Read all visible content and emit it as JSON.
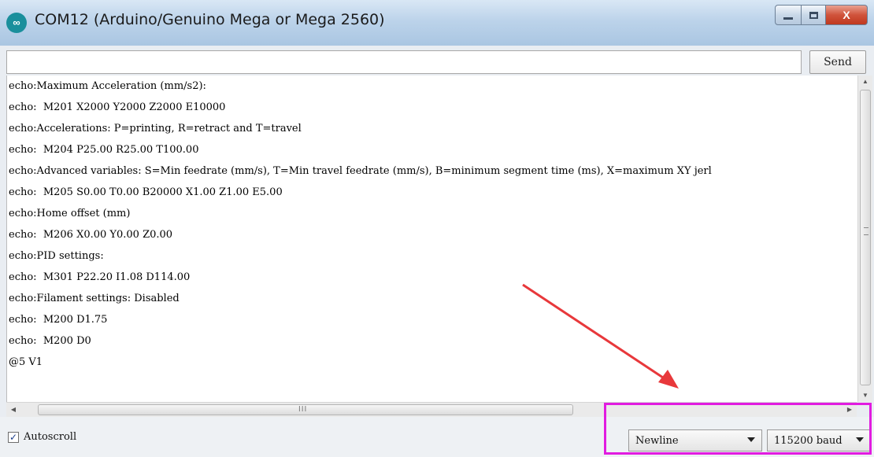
{
  "window": {
    "title": "COM12 (Arduino/Genuino Mega or Mega 2560)",
    "app_icon_glyph": "∞",
    "close_glyph": "X"
  },
  "send": {
    "input_value": "",
    "button_label": "Send"
  },
  "output": {
    "lines": [
      "echo:Maximum Acceleration (mm/s2):",
      "echo:  M201 X2000 Y2000 Z2000 E10000",
      "echo:Accelerations: P=printing, R=retract and T=travel",
      "echo:  M204 P25.00 R25.00 T100.00",
      "echo:Advanced variables: S=Min feedrate (mm/s), T=Min travel feedrate (mm/s), B=minimum segment time (ms), X=maximum XY jerl",
      "echo:  M205 S0.00 T0.00 B20000 X1.00 Z1.00 E5.00",
      "echo:Home offset (mm)",
      "echo:  M206 X0.00 Y0.00 Z0.00",
      "echo:PID settings:",
      "echo:  M301 P22.20 I1.08 D114.00",
      "echo:Filament settings: Disabled",
      "echo:  M200 D1.75",
      "echo:  M200 D0",
      "@5 V1"
    ]
  },
  "scrollbars": {
    "up_glyph": "▲",
    "down_glyph": "▼",
    "left_glyph": "◀",
    "right_glyph": "▶",
    "h_grip": "III"
  },
  "bottom": {
    "autoscroll_label": "Autoscroll",
    "autoscroll_checked": true,
    "check_glyph": "✓",
    "line_ending": "Newline",
    "baud_rate": "115200 baud"
  },
  "annotation": {
    "highlight_color": "#e11ce0",
    "arrow_color": "#e8383b"
  }
}
